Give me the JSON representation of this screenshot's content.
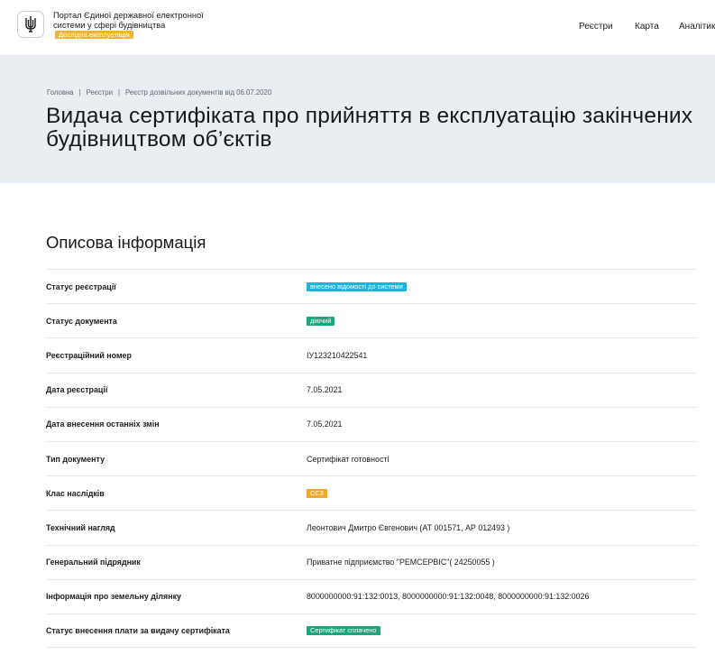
{
  "header": {
    "portal_title": "Портал Єдиної державної електронної системи у сфері будівництва",
    "beta_badge": "Дослідна експлуатація",
    "nav": [
      "Реєстри",
      "Карта",
      "Аналітика"
    ]
  },
  "breadcrumb": [
    "Головна",
    "Реєстри",
    "Реєстр дозвільних документів від 06.07.2020"
  ],
  "page_title_lines": [
    "Видача сертифіката про прийняття в експлуатацію закінчених",
    "будівництвом об’єктів"
  ],
  "section_title": "Описова інформація",
  "rows": [
    {
      "label": "Статус реєстрації",
      "value": "внесено відомості до системи",
      "badge": true,
      "badge_color": "#1fb3d9"
    },
    {
      "label": "Статус документа",
      "value": "діючий",
      "badge": true,
      "badge_color": "#1aa67a"
    },
    {
      "label": "Реєстраційний номер",
      "value": "ІУ123210422541",
      "badge": false
    },
    {
      "label": "Дата реєстрації",
      "value": "7.05.2021",
      "badge": false
    },
    {
      "label": "Дата внесення останніх змін",
      "value": "7.05.2021",
      "badge": false
    },
    {
      "label": "Тип документу",
      "value": "Сертифікат готовності",
      "badge": false
    },
    {
      "label": "Клас наслідків",
      "value": "СС3",
      "badge": true,
      "badge_color": "#f0a92a"
    },
    {
      "label": "Технічний нагляд",
      "value": "Леонтович Дмитро Євгенович (АТ 001571, АР 012493 )",
      "badge": false
    },
    {
      "label": "Генеральний підрядник",
      "value": "Приватне підприємство \"РЕМСЕРВІС\"( 24250055 )",
      "badge": false
    },
    {
      "label": "Інформація про земельну ділянку",
      "value": "8000000000:91:132:0013, 8000000000:91:132:0048, 8000000000:91:132:0026",
      "badge": false
    },
    {
      "label": "Статус внесення плати за видачу сертифіката",
      "value": "Сертифікат сплачено",
      "badge": true,
      "badge_color": "#1aa67a"
    }
  ],
  "colors": {
    "hero_bg": "#e9eef3",
    "beta_badge": "#f5b335"
  },
  "icons": {
    "logo": "trident-icon"
  }
}
